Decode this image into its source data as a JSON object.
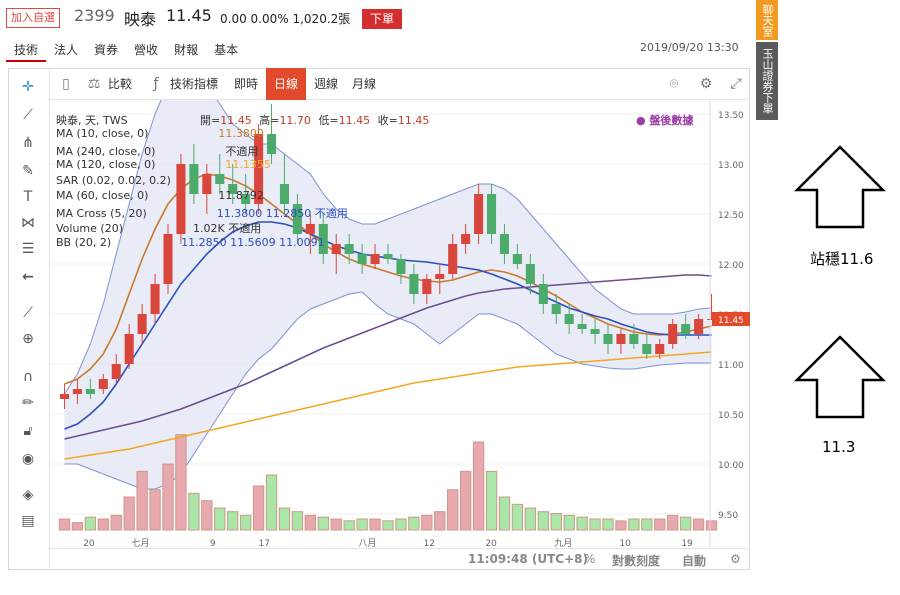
{
  "header": {
    "fav_label": "加入自選",
    "code": "2399",
    "name": "映泰",
    "price": "11.45",
    "change": "0.00 0.00% 1,020.2張",
    "order_button": "下單"
  },
  "tabs": [
    {
      "label": "技術"
    },
    {
      "label": "法人"
    },
    {
      "label": "資券"
    },
    {
      "label": "營收"
    },
    {
      "label": "財報"
    },
    {
      "label": "基本"
    }
  ],
  "datetime": "2019/09/20 13:30",
  "side": {
    "chat": "聊天室",
    "broker": "玉山證券下單"
  },
  "toolbar": {
    "compare": "比較",
    "indicators": "技術指標",
    "realtime": "即時",
    "day": "日線",
    "week": "週線",
    "month": "月線"
  },
  "tools": [
    "crosshair-icon",
    "line-icon",
    "fork-icon",
    "brush-icon",
    "text-icon",
    "pattern-icon",
    "fib-icon",
    "back-arrow-icon",
    "ruler-icon",
    "zoom-in-icon",
    "magnet-icon",
    "pencil-lock-icon",
    "lock-icon",
    "eye-icon",
    "layers-icon",
    "trash-icon"
  ],
  "legend": {
    "title": "映泰, 天, TWS",
    "ohlc": {
      "open_label": "開=",
      "open": "11.45",
      "high_label": "高=",
      "high": "11.70",
      "low_label": "低=",
      "low": "11.45",
      "close_label": "收=",
      "close": "11.45"
    },
    "after_hours": "盤後數據",
    "rows": [
      {
        "name": "MA (10, close, 0)",
        "value": "11.3800",
        "color": "#c97a2b"
      },
      {
        "name": "MA (240, close, 0)",
        "value": "不適用",
        "color": "#333333"
      },
      {
        "name": "MA (120, close, 0)",
        "value": "11.1355",
        "color": "#f5a623"
      },
      {
        "name": "SAR (0.02, 0.02, 0.2)",
        "value": "",
        "color": "#aaaaaa"
      },
      {
        "name": "MA (60, close, 0)",
        "value": "11.8792",
        "color": "#333333"
      },
      {
        "name": "MA Cross (5, 20)",
        "value": "11.3800 11.2850 不適用",
        "color": "#2a4fbf"
      },
      {
        "name": "Volume (20)",
        "value": "1.02K 不適用",
        "color": "#333333"
      },
      {
        "name": "BB (20, 2)",
        "value": "11.2850 11.5609 11.0091",
        "color": "#2a4fbf"
      }
    ]
  },
  "price_axis": {
    "ticks": [
      "13.50",
      "13.00",
      "12.50",
      "12.00",
      "11.50",
      "11.00",
      "10.50",
      "10.00",
      "9.50"
    ],
    "current": "11.45"
  },
  "bottom": {
    "time": "11:09:48 (UTC+8)",
    "percent": "%",
    "log": "對數刻度",
    "auto": "自動"
  },
  "annotations": {
    "resistance": "站穩11.6",
    "support": "11.3"
  },
  "chart_data": {
    "type": "candlestick",
    "x_labels": [
      "20",
      "七月",
      "9",
      "17",
      "八月",
      "12",
      "20",
      "九月",
      "10",
      "19"
    ],
    "ylim": [
      9.3,
      13.6
    ],
    "candles": [
      [
        10.65,
        10.8,
        10.55,
        10.7
      ],
      [
        10.7,
        10.85,
        10.6,
        10.75
      ],
      [
        10.75,
        10.85,
        10.65,
        10.7
      ],
      [
        10.75,
        10.9,
        10.7,
        10.85
      ],
      [
        10.85,
        11.1,
        10.8,
        11.0
      ],
      [
        11.0,
        11.4,
        10.95,
        11.3
      ],
      [
        11.3,
        11.6,
        11.2,
        11.5
      ],
      [
        11.5,
        11.9,
        11.4,
        11.8
      ],
      [
        11.8,
        12.4,
        11.7,
        12.3
      ],
      [
        12.3,
        13.1,
        12.2,
        13.0
      ],
      [
        13.0,
        13.2,
        12.6,
        12.7
      ],
      [
        12.7,
        13.0,
        12.5,
        12.9
      ],
      [
        12.9,
        13.1,
        12.7,
        12.8
      ],
      [
        12.8,
        13.0,
        12.6,
        12.7
      ],
      [
        12.7,
        12.9,
        12.5,
        12.6
      ],
      [
        12.6,
        13.4,
        12.5,
        13.3
      ],
      [
        13.3,
        13.6,
        13.0,
        13.1
      ],
      [
        12.8,
        13.1,
        12.5,
        12.6
      ],
      [
        12.6,
        12.7,
        12.2,
        12.3
      ],
      [
        12.3,
        12.5,
        12.1,
        12.4
      ],
      [
        12.4,
        12.5,
        12.0,
        12.1
      ],
      [
        12.1,
        12.3,
        11.9,
        12.2
      ],
      [
        12.2,
        12.3,
        12.0,
        12.1
      ],
      [
        12.1,
        12.2,
        11.9,
        12.0
      ],
      [
        12.0,
        12.2,
        11.95,
        12.1
      ],
      [
        12.1,
        12.2,
        12.0,
        12.05
      ],
      [
        12.05,
        12.1,
        11.8,
        11.9
      ],
      [
        11.9,
        12.0,
        11.6,
        11.7
      ],
      [
        11.7,
        11.9,
        11.6,
        11.85
      ],
      [
        11.85,
        12.0,
        11.7,
        11.9
      ],
      [
        11.9,
        12.3,
        11.85,
        12.2
      ],
      [
        12.2,
        12.4,
        12.1,
        12.3
      ],
      [
        12.3,
        12.8,
        12.2,
        12.7
      ],
      [
        12.7,
        12.8,
        12.2,
        12.3
      ],
      [
        12.3,
        12.4,
        12.0,
        12.1
      ],
      [
        12.1,
        12.2,
        11.95,
        12.0
      ],
      [
        12.0,
        12.1,
        11.7,
        11.8
      ],
      [
        11.8,
        11.9,
        11.5,
        11.6
      ],
      [
        11.6,
        11.7,
        11.4,
        11.5
      ],
      [
        11.5,
        11.6,
        11.3,
        11.4
      ],
      [
        11.4,
        11.5,
        11.3,
        11.35
      ],
      [
        11.35,
        11.45,
        11.2,
        11.3
      ],
      [
        11.3,
        11.4,
        11.1,
        11.2
      ],
      [
        11.2,
        11.35,
        11.1,
        11.3
      ],
      [
        11.3,
        11.4,
        11.15,
        11.2
      ],
      [
        11.2,
        11.3,
        11.05,
        11.1
      ],
      [
        11.1,
        11.25,
        11.05,
        11.2
      ],
      [
        11.2,
        11.45,
        11.15,
        11.4
      ],
      [
        11.4,
        11.5,
        11.25,
        11.3
      ],
      [
        11.3,
        11.5,
        11.25,
        11.45
      ],
      [
        11.45,
        11.7,
        11.45,
        11.45
      ]
    ],
    "volumes": [
      0.3,
      0.2,
      0.35,
      0.3,
      0.4,
      0.9,
      1.6,
      1.1,
      1.8,
      2.6,
      1.0,
      0.8,
      0.6,
      0.5,
      0.4,
      1.2,
      1.5,
      0.6,
      0.5,
      0.4,
      0.35,
      0.3,
      0.25,
      0.3,
      0.3,
      0.25,
      0.3,
      0.35,
      0.4,
      0.5,
      1.1,
      1.6,
      2.4,
      1.6,
      0.9,
      0.7,
      0.6,
      0.5,
      0.45,
      0.4,
      0.35,
      0.3,
      0.3,
      0.25,
      0.3,
      0.3,
      0.3,
      0.4,
      0.35,
      0.3,
      0.25
    ],
    "series": [
      {
        "name": "MA (10, close, 0)",
        "color": "#c97a2b",
        "values": [
          10.8,
          10.85,
          10.95,
          11.1,
          11.35,
          11.7,
          12.05,
          12.35,
          12.6,
          12.75,
          12.85,
          12.9,
          12.88,
          12.84,
          12.78,
          12.7,
          12.6,
          12.5,
          12.4,
          12.3,
          12.2,
          12.12,
          12.05,
          12.0,
          11.96,
          11.92,
          11.88,
          11.85,
          11.83,
          11.82,
          11.84,
          11.88,
          11.92,
          11.94,
          11.92,
          11.88,
          11.82,
          11.75,
          11.68,
          11.6,
          11.52,
          11.46,
          11.4,
          11.36,
          11.32,
          11.3,
          11.29,
          11.3,
          11.32,
          11.35,
          11.38
        ]
      },
      {
        "name": "MA Cross (5, 20)",
        "color": "#2a4fbf",
        "values": [
          10.35,
          10.4,
          10.5,
          10.62,
          10.8,
          11.0,
          11.2,
          11.4,
          11.6,
          11.8,
          11.95,
          12.1,
          12.22,
          12.32,
          12.38,
          12.42,
          12.42,
          12.4,
          12.36,
          12.3,
          12.24,
          12.18,
          12.14,
          12.1,
          12.08,
          12.06,
          12.04,
          12.03,
          12.02,
          12.0,
          11.98,
          11.96,
          11.94,
          11.9,
          11.85,
          11.8,
          11.74,
          11.68,
          11.62,
          11.56,
          11.52,
          11.48,
          11.45,
          11.4,
          11.36,
          11.32,
          11.3,
          11.29,
          11.29,
          11.29,
          11.29
        ]
      },
      {
        "name": "MA (60, close, 0)",
        "color": "#6b4f90",
        "values": [
          10.25,
          10.28,
          10.31,
          10.34,
          10.37,
          10.4,
          10.43,
          10.47,
          10.51,
          10.55,
          10.6,
          10.65,
          10.7,
          10.75,
          10.8,
          10.86,
          10.92,
          10.98,
          11.04,
          11.1,
          11.16,
          11.21,
          11.26,
          11.31,
          11.36,
          11.41,
          11.46,
          11.51,
          11.56,
          11.6,
          11.64,
          11.68,
          11.71,
          11.73,
          11.75,
          11.76,
          11.77,
          11.78,
          11.79,
          11.8,
          11.81,
          11.82,
          11.83,
          11.84,
          11.85,
          11.86,
          11.87,
          11.88,
          11.89,
          11.89,
          11.88
        ]
      },
      {
        "name": "MA (120, close, 0)",
        "color": "#f5a623",
        "values": [
          10.05,
          10.07,
          10.09,
          10.11,
          10.13,
          10.15,
          10.18,
          10.21,
          10.24,
          10.27,
          10.3,
          10.33,
          10.36,
          10.39,
          10.42,
          10.45,
          10.48,
          10.51,
          10.54,
          10.57,
          10.6,
          10.63,
          10.66,
          10.69,
          10.72,
          10.75,
          10.78,
          10.81,
          10.83,
          10.85,
          10.87,
          10.89,
          10.91,
          10.93,
          10.95,
          10.97,
          10.98,
          10.99,
          11.0,
          11.01,
          11.02,
          11.03,
          11.04,
          11.05,
          11.06,
          11.07,
          11.08,
          11.09,
          11.1,
          11.11,
          11.12
        ]
      }
    ],
    "bands": {
      "name": "BB (20, 2)",
      "upper": [
        10.7,
        10.9,
        11.2,
        11.6,
        12.1,
        12.6,
        13.1,
        13.5,
        13.8,
        13.9,
        13.9,
        13.8,
        13.6,
        13.4,
        13.3,
        13.2,
        13.2,
        13.1,
        13.0,
        12.9,
        12.7,
        12.55,
        12.45,
        12.4,
        12.4,
        12.45,
        12.5,
        12.55,
        12.6,
        12.65,
        12.7,
        12.75,
        12.8,
        12.8,
        12.75,
        12.65,
        12.5,
        12.35,
        12.2,
        12.05,
        11.9,
        11.75,
        11.65,
        11.55,
        11.5,
        11.5,
        11.5,
        11.5,
        11.52,
        11.55,
        11.56
      ],
      "lower": [
        10.0,
        10.0,
        9.95,
        9.9,
        9.85,
        9.8,
        9.75,
        9.75,
        9.8,
        9.9,
        10.1,
        10.3,
        10.5,
        10.7,
        10.9,
        11.05,
        11.15,
        11.3,
        11.45,
        11.55,
        11.6,
        11.65,
        11.7,
        11.72,
        11.6,
        11.5,
        11.45,
        11.4,
        11.3,
        11.2,
        11.3,
        11.4,
        11.5,
        11.5,
        11.45,
        11.4,
        11.3,
        11.2,
        11.1,
        11.05,
        11.0,
        10.98,
        10.96,
        10.95,
        10.95,
        10.97,
        10.99,
        11.0,
        11.01,
        11.01,
        11.01
      ]
    }
  }
}
